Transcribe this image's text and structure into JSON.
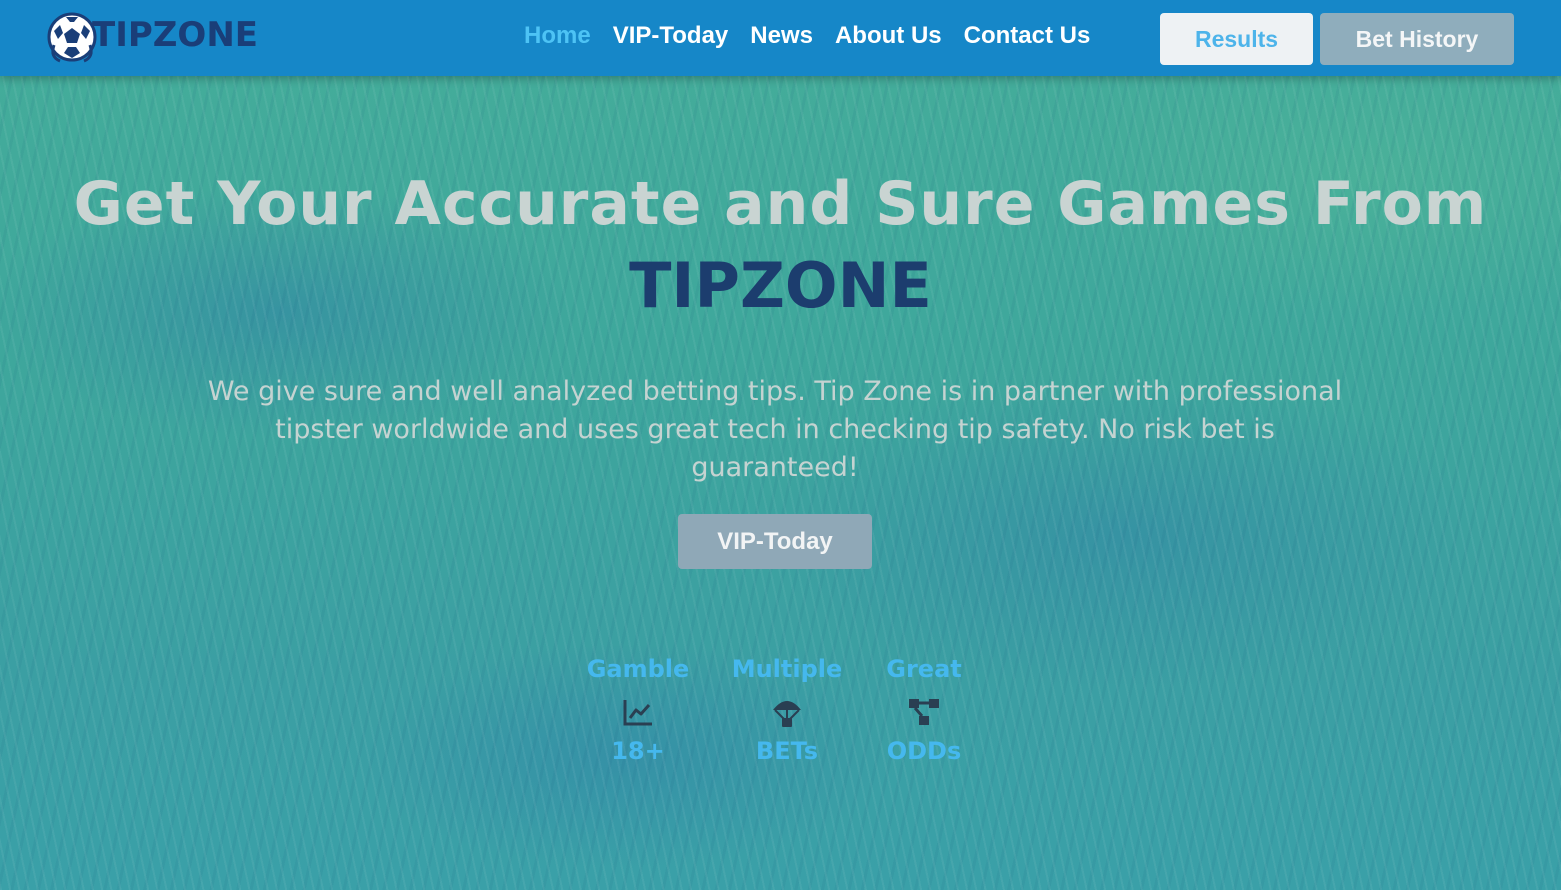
{
  "brand": {
    "logo_text": "TIPZONE"
  },
  "nav": {
    "links": [
      {
        "label": "Home",
        "active": true
      },
      {
        "label": "VIP-Today"
      },
      {
        "label": "News"
      },
      {
        "label": "About Us"
      },
      {
        "label": "Contact Us"
      }
    ],
    "results_label": "Results",
    "bet_history_label": "Bet History"
  },
  "hero": {
    "title": "Get Your Accurate and Sure Games From",
    "brand": "TIPZONE",
    "description": "We give sure and well analyzed betting tips. Tip Zone is in partner with professional tipster worldwide and uses great tech in checking tip safety. No risk bet is guaranteed!",
    "cta_label": "VIP-Today"
  },
  "features": [
    {
      "title": "Gamble",
      "icon": "chart-line-icon",
      "value": "18+"
    },
    {
      "title": "Multiple",
      "icon": "parachute-icon",
      "value": "BETs"
    },
    {
      "title": "Great",
      "icon": "network-icon",
      "value": "ODDs"
    }
  ],
  "colors": {
    "navbar": "#1687c8",
    "nav_active": "#4dc3f5",
    "brand_dark": "#1c3d6e",
    "feature_text": "#45b8ee",
    "results_bg": "#eef2f4",
    "history_bg": "#8fadbc"
  }
}
